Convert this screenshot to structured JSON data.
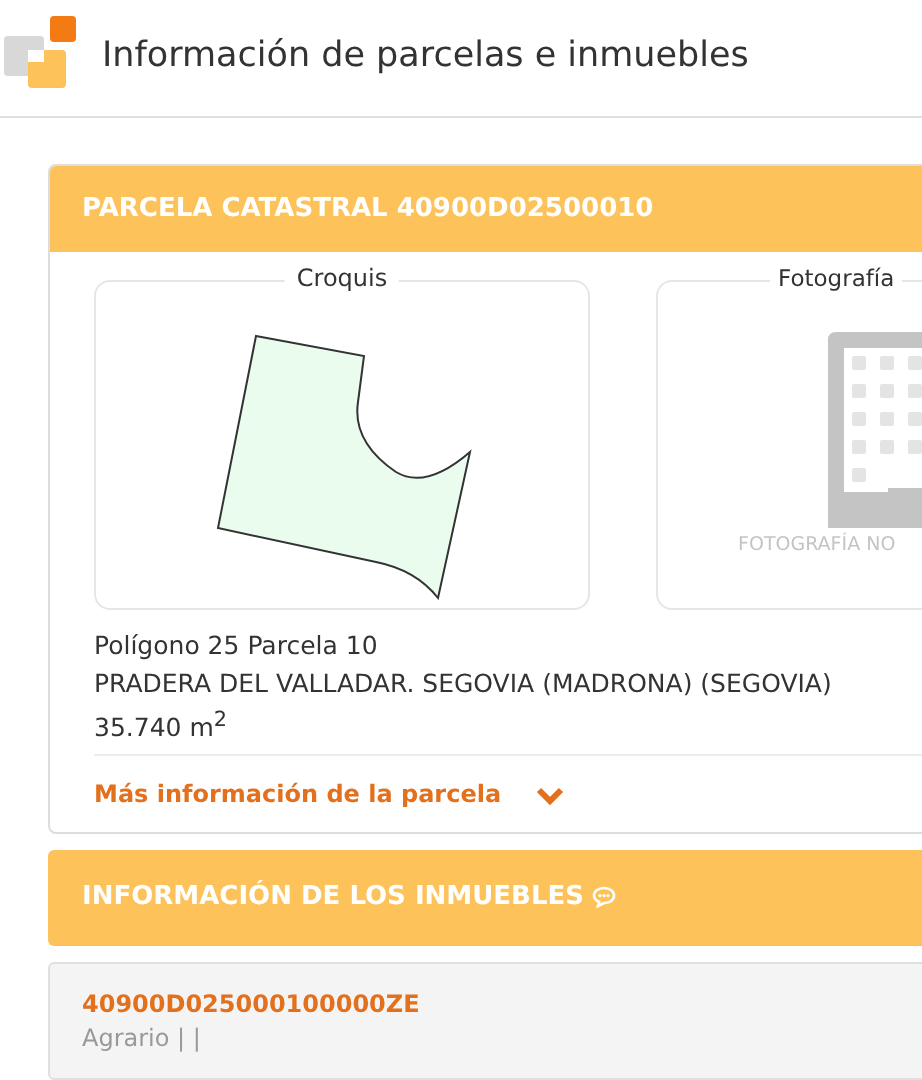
{
  "header": {
    "title": "Información de parcelas e inmuebles"
  },
  "parcel": {
    "title": "PARCELA CATASTRAL 40900D02500010",
    "sketch": {
      "legend": "Croquis"
    },
    "photo": {
      "legend": "Fotografía",
      "caption": "FOTOGRAFÍA NO"
    },
    "lines": [
      "Polígono 25 Parcela 10",
      "PRADERA DEL VALLADAR. SEGOVIA (MADRONA) (SEGOVIA)",
      "35.740 m$^{2}$"
    ],
    "more_link": {
      "label": "Más información de la parcela",
      "expanded": false
    }
  },
  "properties": {
    "title": "INFORMACIÓN DE LOS INMUEBLES",
    "items": [
      {
        "reference": "40900D025000100000ZE",
        "detail": "Agrario | |"
      }
    ]
  }
}
